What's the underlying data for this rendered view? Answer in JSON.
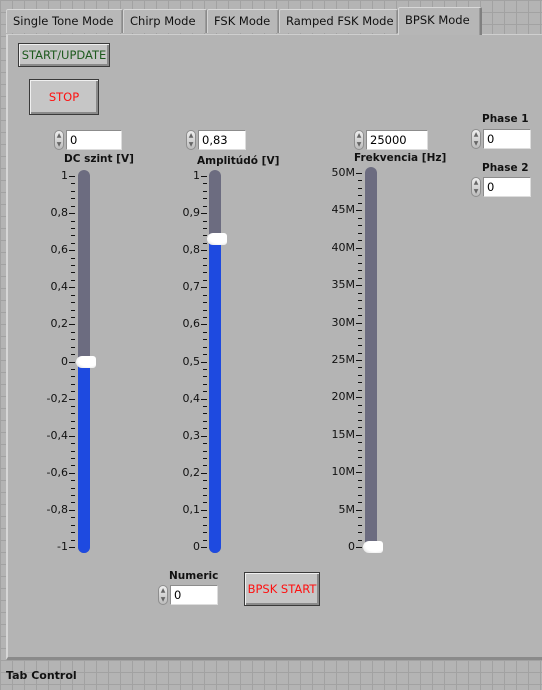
{
  "tabs": [
    {
      "label": "Single Tone Mode",
      "active": false
    },
    {
      "label": "Chirp Mode",
      "active": false
    },
    {
      "label": "FSK Mode",
      "active": false
    },
    {
      "label": "Ramped FSK Mode",
      "active": false
    },
    {
      "label": "BPSK Mode",
      "active": true
    }
  ],
  "buttons": {
    "start_update": "START/UPDATE",
    "stop": "STOP",
    "bpsk_start": "BPSK START"
  },
  "colors": {
    "start_text": "#1e5a1e",
    "stop_text": "#ff1010",
    "slider_fill": "#1e4ae0",
    "slider_track": "#6c6c80"
  },
  "controls": {
    "dc": {
      "label": "DC szint [V]",
      "value": "0",
      "min": -1,
      "max": 1,
      "current": 0,
      "ticks": [
        "1",
        "0,8",
        "0,6",
        "0,4",
        "0,2",
        "0",
        "-0,2",
        "-0,4",
        "-0,6",
        "-0,8",
        "-1"
      ]
    },
    "amp": {
      "label": "Amplitúdó [V]",
      "value": "0,83",
      "min": 0,
      "max": 1,
      "current": 0.83,
      "ticks": [
        "1",
        "0,9",
        "0,8",
        "0,7",
        "0,6",
        "0,5",
        "0,4",
        "0,3",
        "0,2",
        "0,1",
        "0"
      ]
    },
    "freq": {
      "label": "Frekvencia [Hz]",
      "value": "25000",
      "min": 0,
      "max": 50000000,
      "current": 25000,
      "ticks": [
        "50M",
        "45M",
        "40M",
        "35M",
        "30M",
        "25M",
        "20M",
        "15M",
        "10M",
        "5M",
        "0"
      ]
    },
    "phase1": {
      "label": "Phase 1",
      "value": "0"
    },
    "phase2": {
      "label": "Phase 2",
      "value": "0"
    },
    "numeric": {
      "label": "Numeric",
      "value": "0"
    }
  },
  "footer": {
    "label": "Tab Control"
  }
}
